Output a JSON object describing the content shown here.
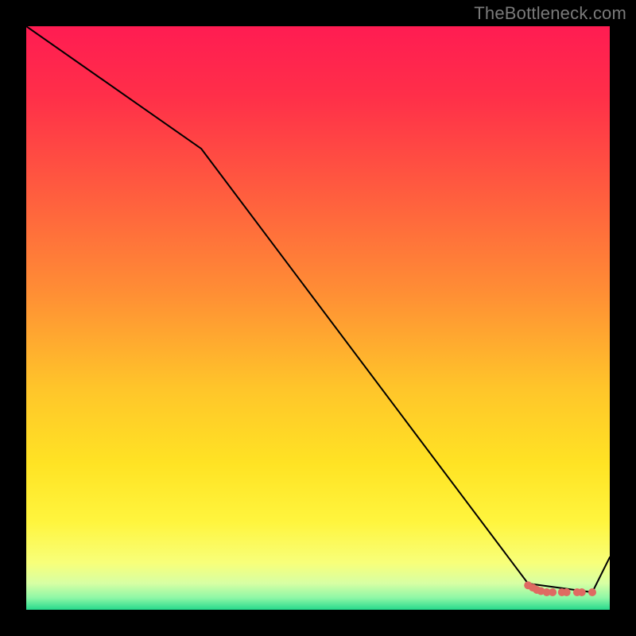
{
  "watermark": "TheBottleneck.com",
  "chart_data": {
    "type": "line",
    "title": "",
    "xlabel": "",
    "ylabel": "",
    "xlim": [
      0,
      100
    ],
    "ylim": [
      0,
      100
    ],
    "grid": false,
    "legend": false,
    "series": [
      {
        "name": "curve",
        "color": "#000000",
        "x": [
          0,
          30,
          86,
          97,
          100
        ],
        "y": [
          100,
          79,
          4.5,
          3,
          9
        ]
      }
    ],
    "scatter": {
      "name": "dots",
      "color": "#df6a62",
      "points": [
        {
          "x": 86.0,
          "y": 4.2
        },
        {
          "x": 86.8,
          "y": 3.8
        },
        {
          "x": 87.5,
          "y": 3.4
        },
        {
          "x": 88.2,
          "y": 3.2
        },
        {
          "x": 89.2,
          "y": 3.0
        },
        {
          "x": 90.2,
          "y": 3.0
        },
        {
          "x": 91.8,
          "y": 3.0
        },
        {
          "x": 92.6,
          "y": 3.0
        },
        {
          "x": 94.4,
          "y": 3.0
        },
        {
          "x": 95.2,
          "y": 3.0
        },
        {
          "x": 97.0,
          "y": 3.0
        }
      ],
      "radius": 5
    },
    "background_gradient": {
      "stops": [
        {
          "offset": 0.0,
          "color": "#ff1c52"
        },
        {
          "offset": 0.12,
          "color": "#ff2f49"
        },
        {
          "offset": 0.28,
          "color": "#ff5b3f"
        },
        {
          "offset": 0.45,
          "color": "#ff8c35"
        },
        {
          "offset": 0.62,
          "color": "#ffc52a"
        },
        {
          "offset": 0.75,
          "color": "#ffe324"
        },
        {
          "offset": 0.85,
          "color": "#fff53e"
        },
        {
          "offset": 0.92,
          "color": "#f8ff7a"
        },
        {
          "offset": 0.955,
          "color": "#d7ffa4"
        },
        {
          "offset": 0.98,
          "color": "#8cf7a6"
        },
        {
          "offset": 1.0,
          "color": "#25d98c"
        }
      ]
    }
  }
}
